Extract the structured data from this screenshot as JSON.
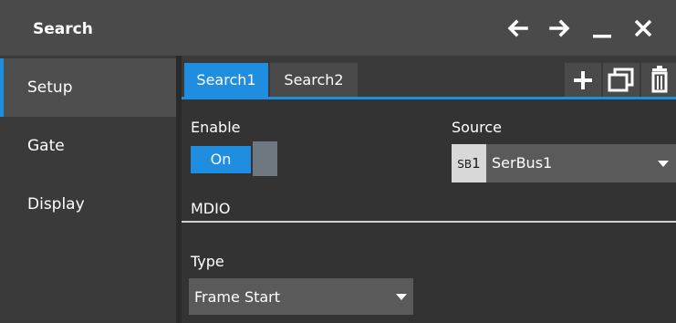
{
  "titlebar": {
    "title": "Search",
    "icons": [
      "arrow-left-icon",
      "arrow-right-icon",
      "minimize-icon",
      "close-icon"
    ]
  },
  "sidebar": {
    "items": [
      {
        "label": "Setup",
        "active": true
      },
      {
        "label": "Gate",
        "active": false
      },
      {
        "label": "Display",
        "active": false
      }
    ]
  },
  "tabs": {
    "items": [
      {
        "label": "Search1",
        "active": true
      },
      {
        "label": "Search2",
        "active": false
      }
    ],
    "icons": [
      "add-icon",
      "copy-icon",
      "delete-icon"
    ]
  },
  "enable": {
    "label": "Enable",
    "value": "On"
  },
  "source": {
    "label": "Source",
    "badge_prefix": "SB",
    "badge_number": "1",
    "value": "SerBus1"
  },
  "section": {
    "title": "MDIO"
  },
  "type": {
    "label": "Type",
    "value": "Frame Start"
  },
  "colors": {
    "accent": "#1f8de0",
    "background": "#3a3a3a",
    "titlebar": "#4a4a4a",
    "dropdown": "#5a5a5a"
  }
}
